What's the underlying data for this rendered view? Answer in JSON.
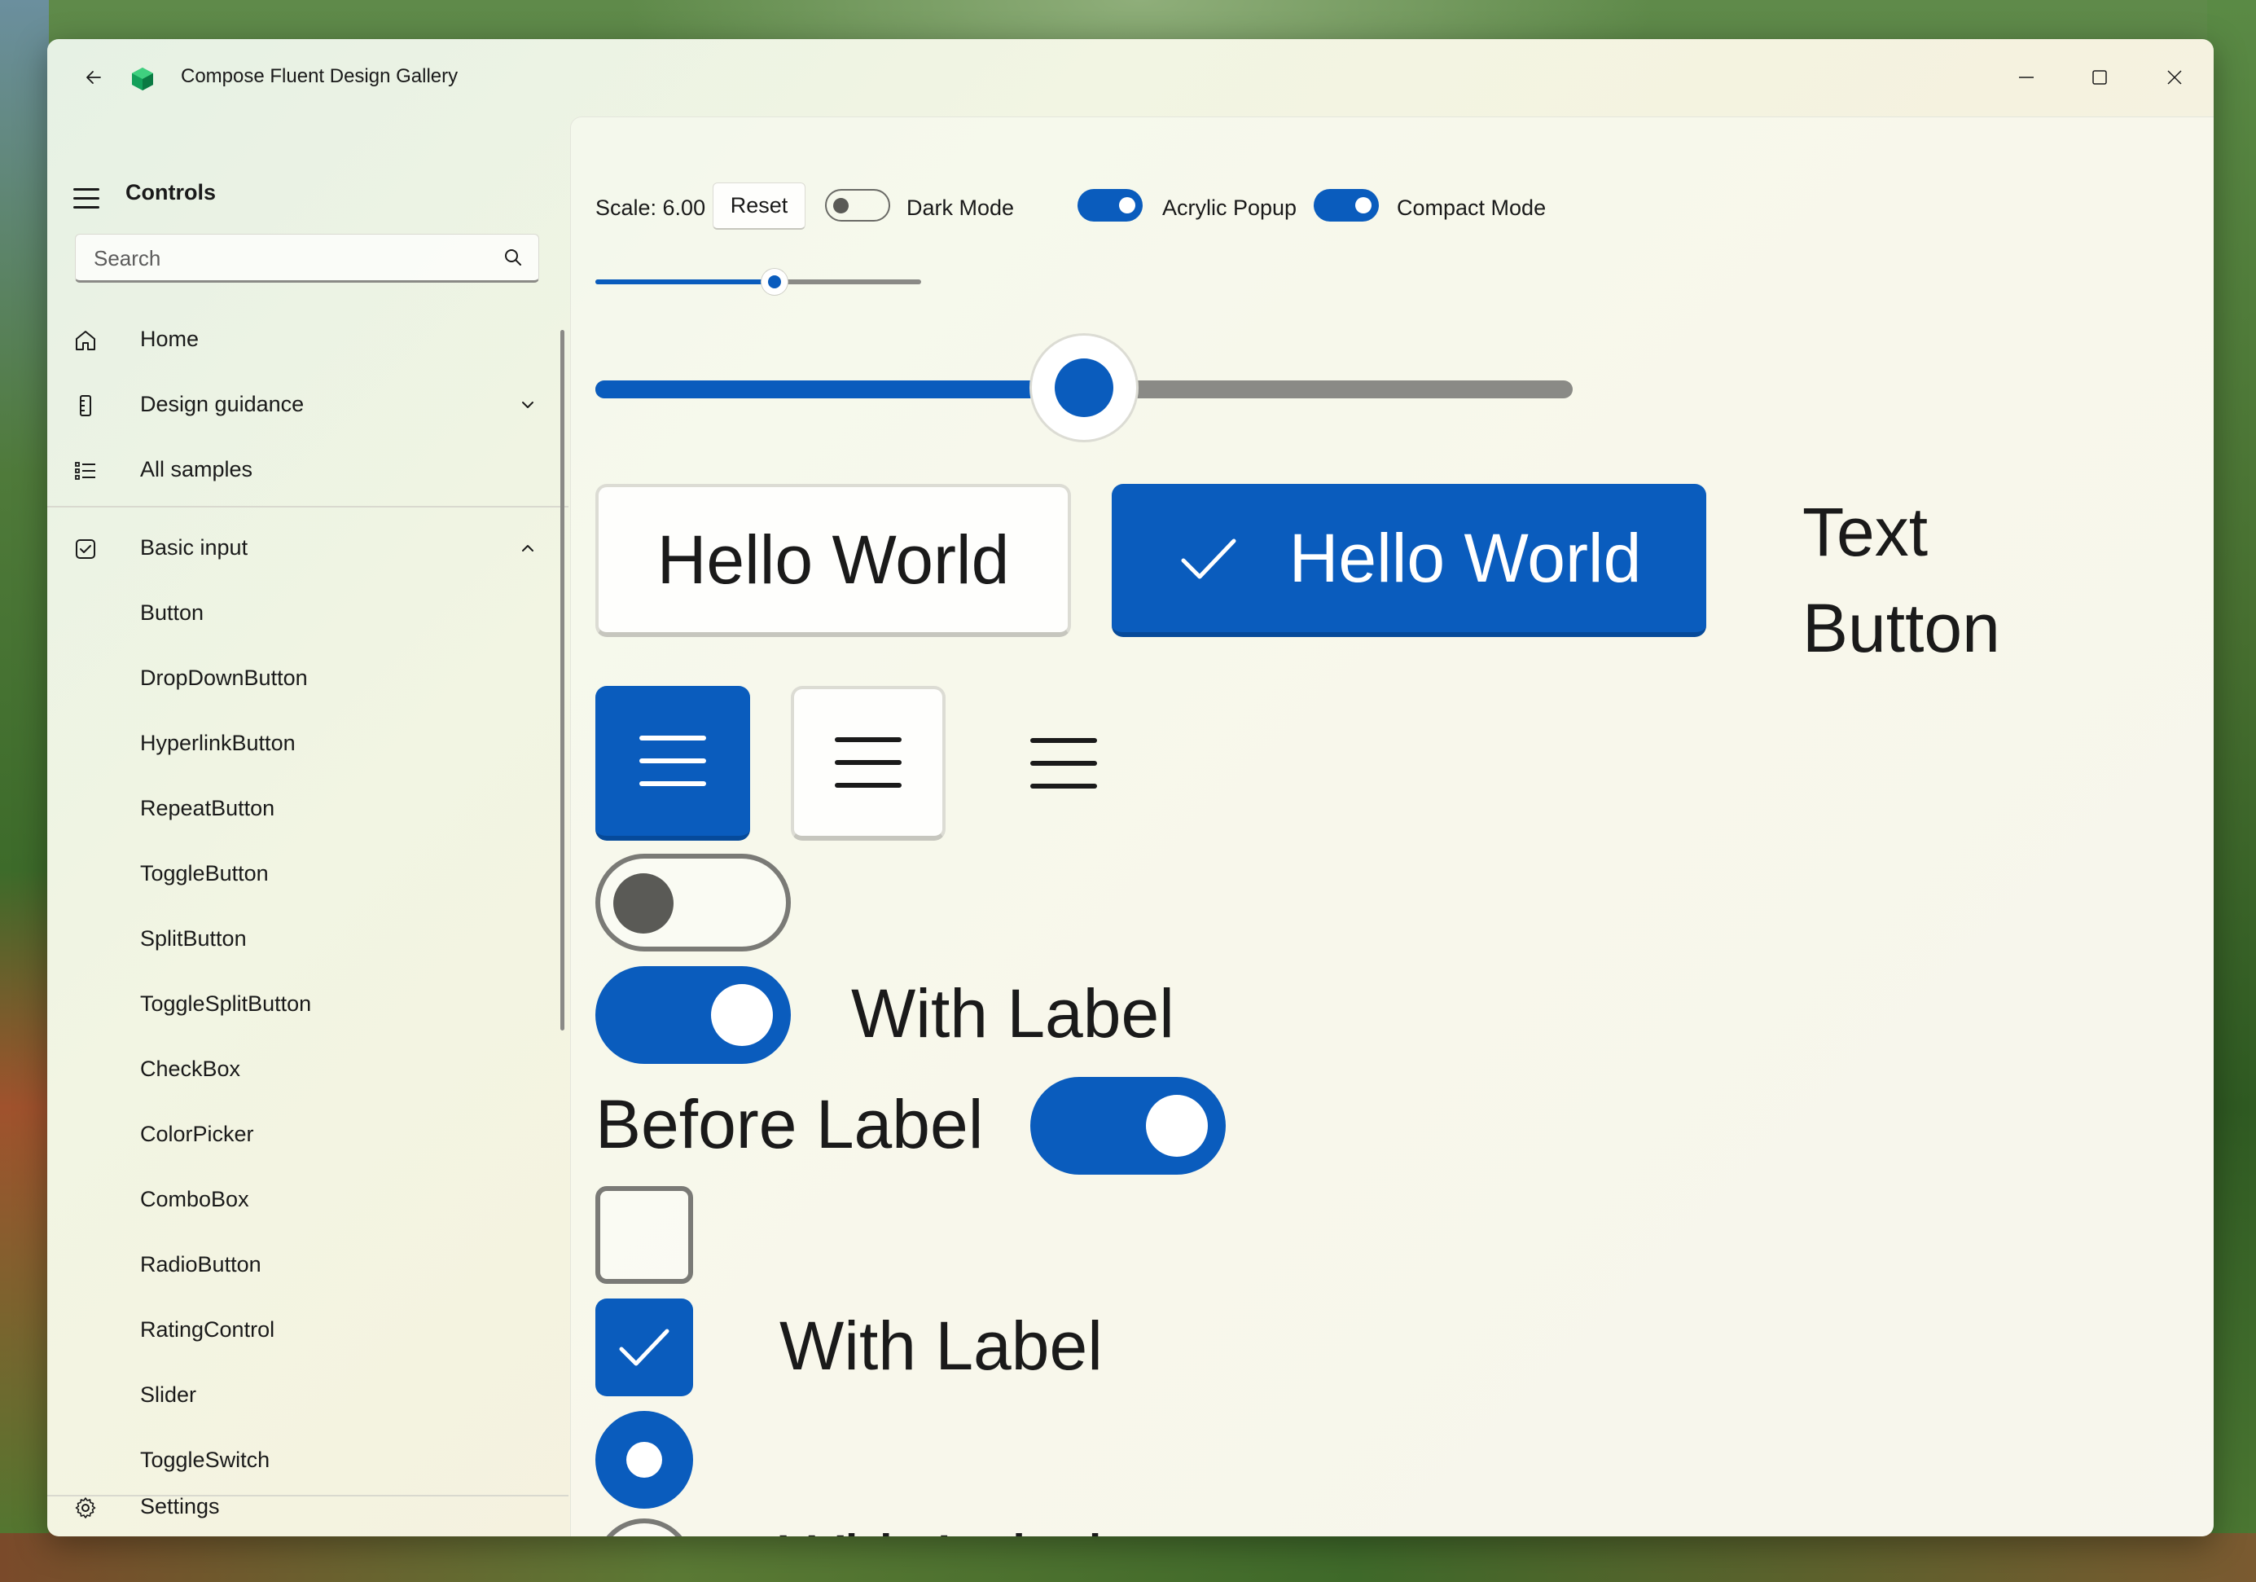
{
  "window": {
    "title": "Compose Fluent Design Gallery"
  },
  "sidebar": {
    "heading": "Controls",
    "search_placeholder": "Search",
    "top_items": [
      {
        "label": "Home",
        "icon": "home-icon"
      },
      {
        "label": "Design guidance",
        "icon": "ruler-icon",
        "expanded": false
      },
      {
        "label": "All samples",
        "icon": "list-icon"
      }
    ],
    "section": {
      "label": "Basic input",
      "icon": "checkbox-icon",
      "expanded": true
    },
    "sub_items": [
      "Button",
      "DropDownButton",
      "HyperlinkButton",
      "RepeatButton",
      "ToggleButton",
      "SplitButton",
      "ToggleSplitButton",
      "CheckBox",
      "ColorPicker",
      "ComboBox",
      "RadioButton",
      "RatingControl",
      "Slider",
      "ToggleSwitch"
    ],
    "settings_label": "Settings"
  },
  "toolbar": {
    "scale_label": "Scale: 6.00",
    "reset_label": "Reset",
    "dark_mode": {
      "label": "Dark Mode",
      "on": false
    },
    "acrylic_popup": {
      "label": "Acrylic Popup",
      "on": true
    },
    "compact_mode": {
      "label": "Compact Mode",
      "on": true
    },
    "scale_slider_fraction": 0.55
  },
  "demo": {
    "big_slider_fraction": 0.5,
    "button_label": "Hello World",
    "accent_button_label": "Hello World",
    "text_button_label": "Text Button",
    "switch_with_label": "With Label",
    "switch_before_label": "Before Label",
    "checkbox_with_label": "With Label",
    "radio_with_label": "With Label"
  },
  "colors": {
    "accent": "#0a5cbd",
    "text": "#1a1a1a"
  }
}
